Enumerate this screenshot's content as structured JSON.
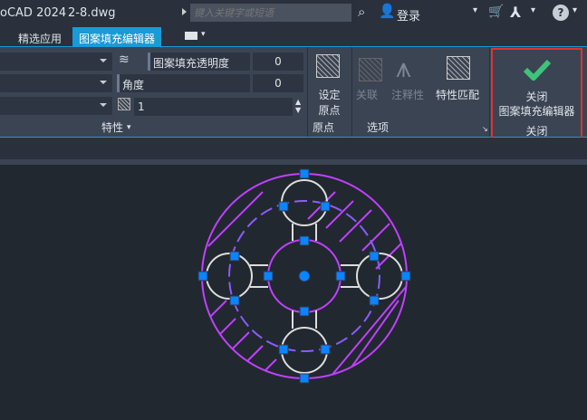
{
  "titlebar": {
    "app": "oCAD 2024",
    "file": "2-8.dwg",
    "search_placeholder": "键入关键字或短语",
    "login": "登录"
  },
  "tabs": [
    {
      "label": "精选应用"
    },
    {
      "label": "图案填充编辑器",
      "active": true
    }
  ],
  "ribbon": {
    "properties": {
      "transparency_label": "图案填充透明度",
      "transparency_value": "0",
      "angle_label": "角度",
      "angle_value": "0",
      "scale_value": "1",
      "panel_label": "特性"
    },
    "origin": {
      "set_origin_line1": "设定",
      "set_origin_line2": "原点",
      "panel_label": "原点"
    },
    "options": {
      "associative": "关联",
      "annotative": "注释性",
      "match_properties": "特性匹配",
      "panel_label": "选项"
    },
    "close": {
      "line1": "关闭",
      "line2": "图案填充编辑器",
      "panel_label": "关闭"
    }
  },
  "colors": {
    "accent": "#1a9ad6",
    "hatch": "#c040ff",
    "grip": "#0a84ff",
    "highlight": "#e0332f",
    "check": "#3dc47a"
  }
}
